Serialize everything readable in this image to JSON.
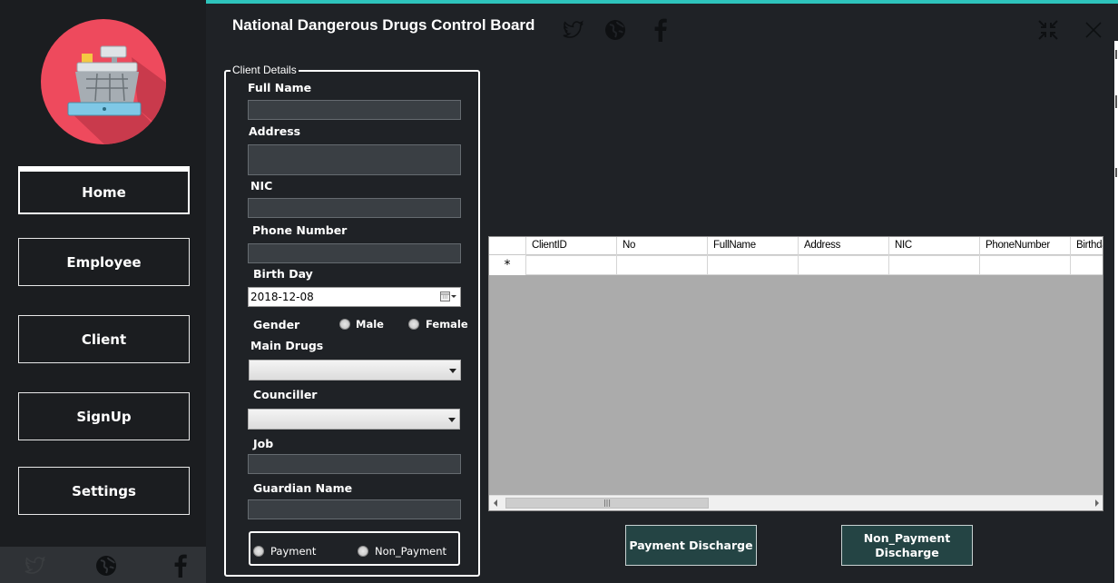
{
  "app": {
    "title": "National Dangerous Drugs Control Board"
  },
  "sidebar": {
    "items": [
      {
        "label": "Home",
        "active": true
      },
      {
        "label": "Employee"
      },
      {
        "label": "Client"
      },
      {
        "label": "SignUp"
      },
      {
        "label": "Settings"
      }
    ],
    "social_icons": [
      "twitter-icon",
      "globe-icon",
      "facebook-icon"
    ]
  },
  "header": {
    "icons": [
      "twitter-icon",
      "globe-icon",
      "facebook-icon"
    ],
    "window_controls": [
      "minimize-icon",
      "close-icon"
    ]
  },
  "client_form": {
    "legend": "Client Details",
    "full_name": {
      "label": "Full Name",
      "value": ""
    },
    "address": {
      "label": "Address",
      "value": ""
    },
    "nic": {
      "label": "NIC",
      "value": ""
    },
    "phone": {
      "label": "Phone Number",
      "value": ""
    },
    "birth_day": {
      "label": "Birth Day",
      "value": "2018-12-08"
    },
    "gender": {
      "label": "Gender",
      "options": [
        "Male",
        "Female"
      ]
    },
    "main_drugs": {
      "label": "Main Drugs",
      "value": ""
    },
    "counciller": {
      "label": "Counciller",
      "value": ""
    },
    "job": {
      "label": "Job",
      "value": ""
    },
    "guardian": {
      "label": "Guardian Name",
      "value": ""
    },
    "payment_options": [
      "Payment",
      "Non_Payment"
    ]
  },
  "grid": {
    "columns": [
      "ClientID",
      "No",
      "FullName",
      "Address",
      "NIC",
      "PhoneNumber",
      "Birthday"
    ],
    "new_row_marker": "*",
    "scroll_grip": "|||"
  },
  "actions": {
    "payment_discharge": "Payment Discharge",
    "non_payment_discharge": "Non_Payment Discharge"
  },
  "colors": {
    "accent": "#2ec4bc",
    "logo": "#ee4a5d",
    "background": "#1f2226",
    "sidebar": "#1b1d20",
    "button": "#244444"
  }
}
